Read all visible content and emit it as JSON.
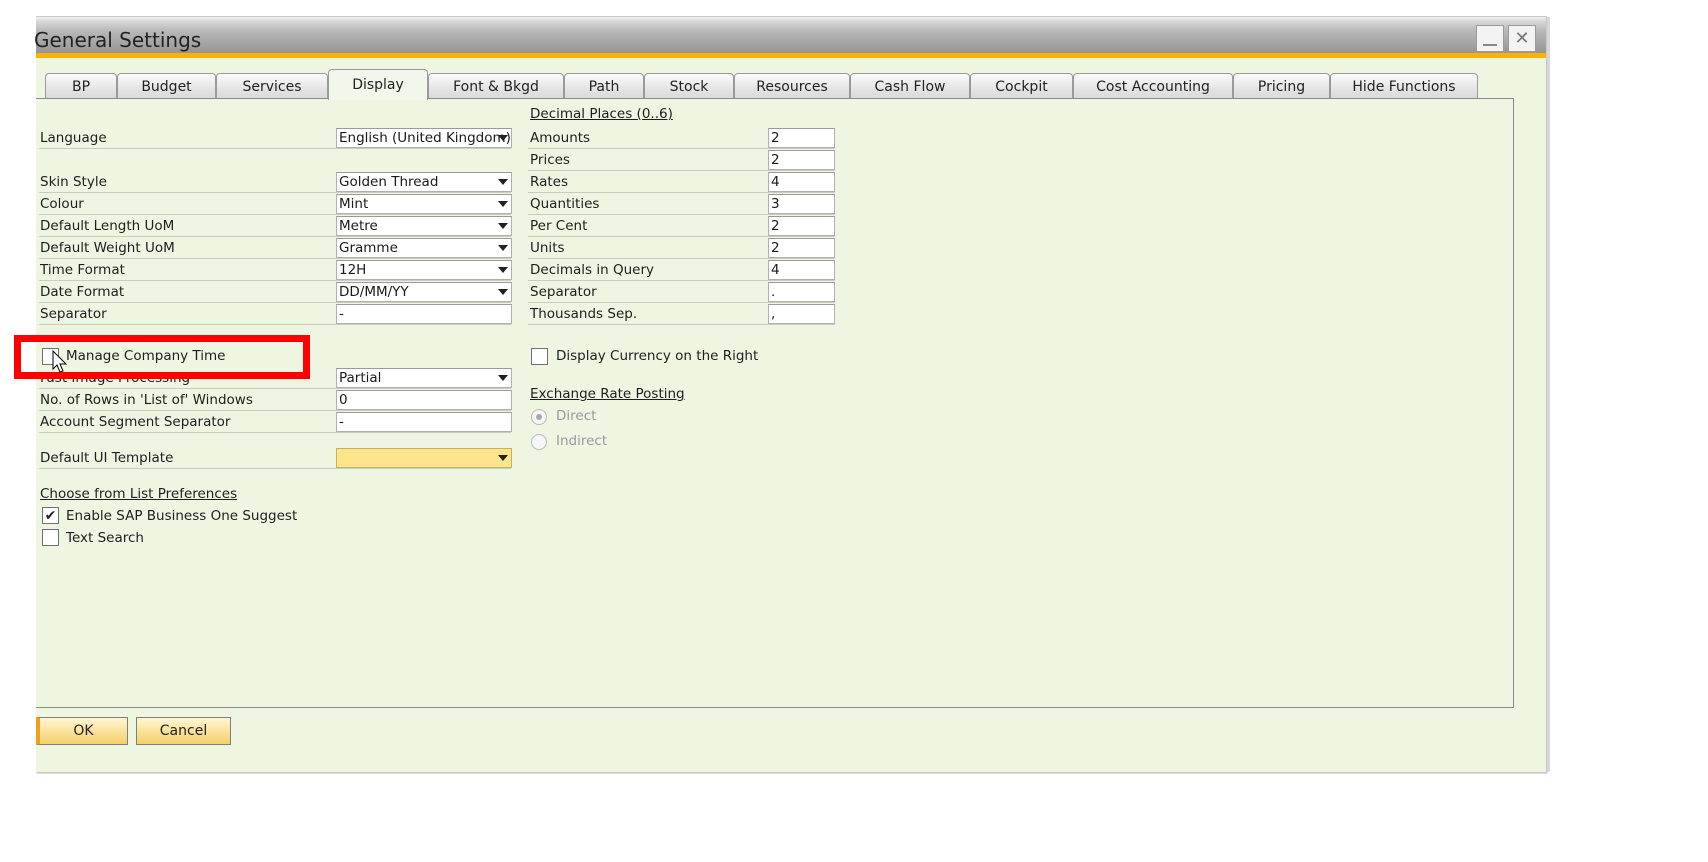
{
  "window": {
    "title": "General Settings",
    "minimize_icon": "minimize-icon",
    "close_icon": "close-icon"
  },
  "tabs": [
    {
      "label": "BP",
      "active": false
    },
    {
      "label": "Budget",
      "active": false
    },
    {
      "label": "Services",
      "active": false
    },
    {
      "label": "Display",
      "active": true
    },
    {
      "label": "Font & Bkgd",
      "active": false
    },
    {
      "label": "Path",
      "active": false
    },
    {
      "label": "Stock",
      "active": false
    },
    {
      "label": "Resources",
      "active": false
    },
    {
      "label": "Cash Flow",
      "active": false
    },
    {
      "label": "Cockpit",
      "active": false
    },
    {
      "label": "Cost Accounting",
      "active": false
    },
    {
      "label": "Pricing",
      "active": false
    },
    {
      "label": "Hide Functions",
      "active": false
    }
  ],
  "left": {
    "language": {
      "label": "Language",
      "value": "English (United Kingdom)"
    },
    "skin_style": {
      "label": "Skin Style",
      "value": "Golden Thread"
    },
    "colour": {
      "label": "Colour",
      "value": "Mint"
    },
    "length_uom": {
      "label": "Default Length UoM",
      "value": "Metre"
    },
    "weight_uom": {
      "label": "Default Weight UoM",
      "value": "Gramme"
    },
    "time_format": {
      "label": "Time Format",
      "value": "12H"
    },
    "date_format": {
      "label": "Date Format",
      "value": "DD/MM/YY"
    },
    "separator": {
      "label": "Separator",
      "value": "-"
    },
    "manage_company_time": {
      "label": "Manage Company Time",
      "checked": false
    },
    "fast_image": {
      "label": "Fast Image Processing",
      "value": "Partial"
    },
    "rows_list": {
      "label": "No. of Rows in 'List of' Windows",
      "value": "0"
    },
    "account_seg_sep": {
      "label": "Account Segment Separator",
      "value": "-"
    },
    "ui_template": {
      "label": "Default UI Template",
      "value": ""
    },
    "cfl_header": "Choose from List Preferences",
    "enable_suggest": {
      "label": "Enable SAP Business One Suggest",
      "checked": true
    },
    "text_search": {
      "label": "Text Search",
      "checked": false
    }
  },
  "right": {
    "decimal_header": "Decimal Places  (0..6)",
    "decimals": [
      {
        "label": "Amounts",
        "value": "2"
      },
      {
        "label": "Prices",
        "value": "2"
      },
      {
        "label": "Rates",
        "value": "4"
      },
      {
        "label": "Quantities",
        "value": "3"
      },
      {
        "label": "Per Cent",
        "value": "2"
      },
      {
        "label": "Units",
        "value": "2"
      },
      {
        "label": "Decimals in Query",
        "value": "4"
      },
      {
        "label": "Separator",
        "value": "."
      },
      {
        "label": "Thousands Sep.",
        "value": ","
      }
    ],
    "display_currency_right": {
      "label": "Display Currency on the Right",
      "checked": false
    },
    "exchange_header": "Exchange Rate Posting",
    "exchange_options": [
      {
        "label": "Direct",
        "selected": true,
        "disabled": true
      },
      {
        "label": "Indirect",
        "selected": false,
        "disabled": true
      }
    ]
  },
  "buttons": {
    "ok": "OK",
    "cancel": "Cancel"
  },
  "annotation": {
    "highlight_color": "#ff0000"
  },
  "colors": {
    "accent": "#f8b400",
    "panel_bg": "#eef6e2",
    "template_field": "#fde38a"
  }
}
